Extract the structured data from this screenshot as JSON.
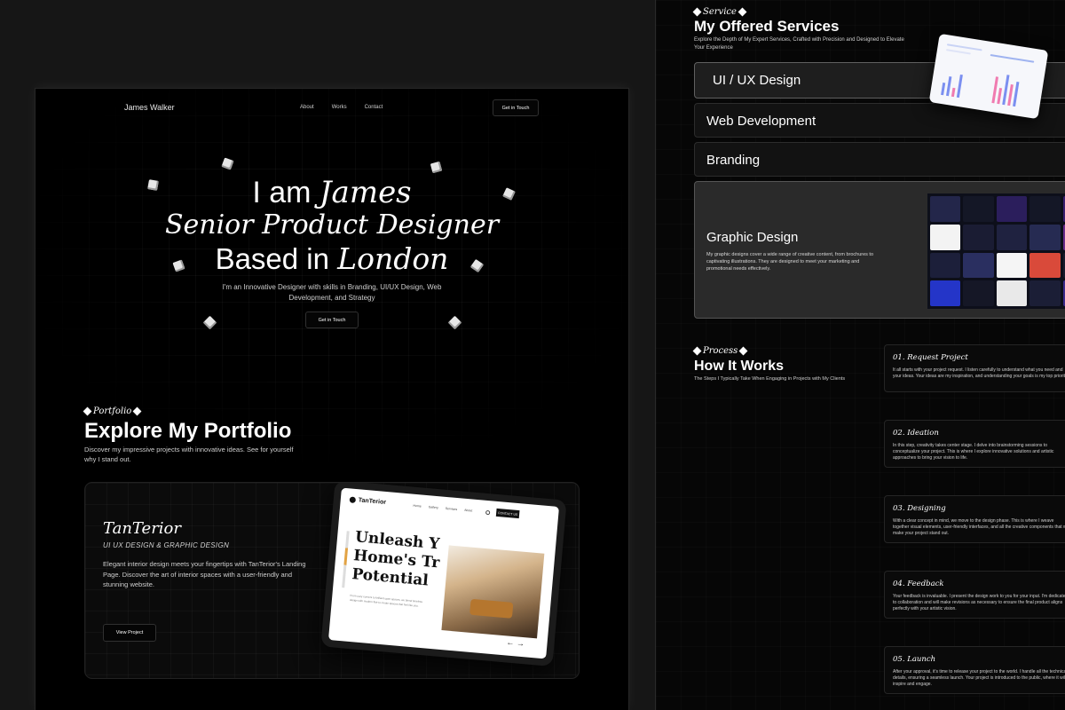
{
  "hero_page": {
    "brand": "James Walker",
    "nav": [
      "About",
      "Works",
      "Contact"
    ],
    "nav_cta": "Get in Touch",
    "hero": {
      "line1_plain": "I am ",
      "line1_italic": "James",
      "line2_italic": "Senior Product Designer",
      "line3_plain": "Based in ",
      "line3_italic": "London",
      "subtitle": "I'm an Innovative Designer with skills in Branding, UI/UX Design, Web Development, and Strategy",
      "cta": "Get in Touch"
    },
    "portfolio": {
      "tag": "Portfolio",
      "title": "Explore My Portfolio",
      "subtitle": "Discover my impressive projects with innovative ideas. See for yourself why I stand out.",
      "project": {
        "title": "TanTerior",
        "category": "UI UX DESIGN & GRAPHIC DESIGN",
        "description": "Elegant interior design meets your fingertips with TanTerior's Landing Page. Discover the art of interior spaces with a user-friendly and stunning website.",
        "button": "View Project",
        "preview": {
          "logo": "TanTerior",
          "nav": [
            "Home",
            "Gallery",
            "Services",
            "About"
          ],
          "button": "CONTACT US",
          "headline": [
            "Unleash Y",
            "Home's Tr",
            "Potential"
          ],
          "small_text": "From cozy corners to brilliant open spaces, we blend timeless design with modern flair to create spaces that feel like you.",
          "arrows": "←  →"
        }
      }
    }
  },
  "services_page": {
    "service_tag": "Service",
    "service_title": "My Offered Services",
    "service_subtitle": "Explore the Depth of My Expert Services, Crafted with Precision and Designed to Elevate Your Experience",
    "services": [
      {
        "label": "UI / UX Design"
      },
      {
        "label": "Web Development"
      },
      {
        "label": "Branding"
      },
      {
        "label": "Graphic Design",
        "description": "My graphic designs cover a wide range of creative content, from brochures to captivating illustrations. They are designed to meet your marketing and promotional needs effectively."
      }
    ],
    "process_tag": "Process",
    "process_title": "How It Works",
    "process_subtitle": "The Steps I Typically Take When Engaging in Projects with My Clients",
    "steps": [
      {
        "title": "01.  Request Project",
        "description": "It all starts with your project request. I listen carefully to understand what you need and your ideas. Your ideas are my inspiration, and understanding your goals is my top priority."
      },
      {
        "title": "02.  Ideation",
        "description": "In this step, creativity takes center stage. I delve into brainstorming sessions to conceptualize your project. This is where I explore innovative solutions and artistic approaches to bring your vision to life."
      },
      {
        "title": "03.  Designing",
        "description": "With a clear concept in mind, we move to the design phase. This is where I weave together visual elements, user-friendly interfaces, and all the creative components that will make your project stand out."
      },
      {
        "title": "04.  Feedback",
        "description": "Your feedback is invaluable. I present the design work to you for your input. I'm dedicated to collaboration and will make revisions as necessary to ensure the final product aligns perfectly with your artistic vision."
      },
      {
        "title": "05.  Launch",
        "description": "After your approval, it's time to release your project to the world. I handle all the technical details, ensuring a seamless launch. Your project is introduced to the public, where it will inspire and engage."
      }
    ]
  }
}
